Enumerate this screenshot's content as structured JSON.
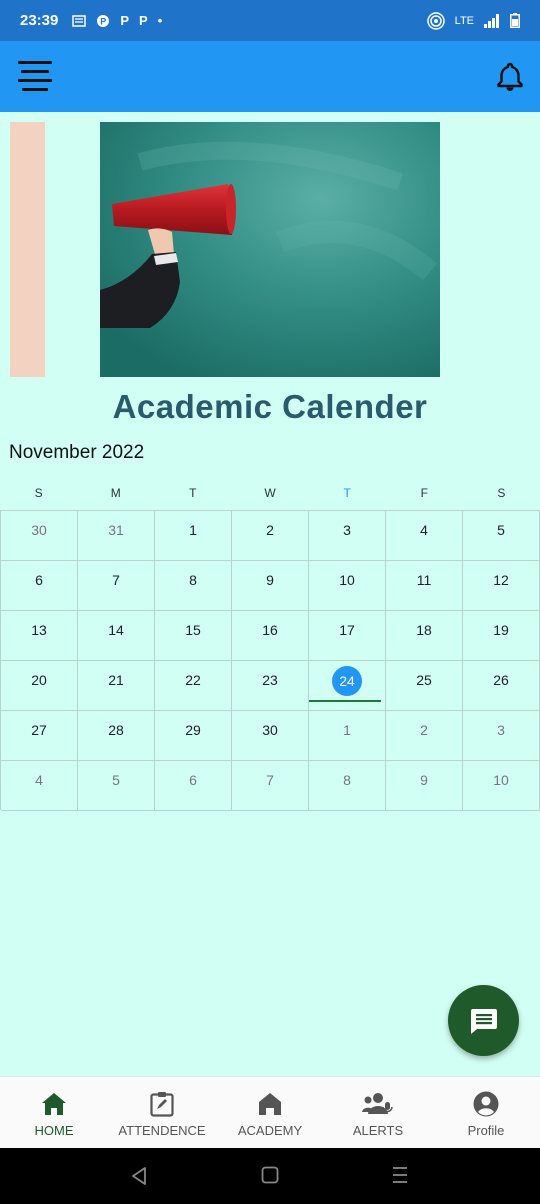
{
  "status_bar": {
    "time": "23:39",
    "left_icons": [
      "news-icon",
      "p-icon",
      "P",
      "P",
      "•"
    ],
    "network": "LTE"
  },
  "app_bar": {
    "menu_icon": "menu-icon",
    "notification_icon": "bell-icon"
  },
  "banner": {
    "image": "megaphone-chalkboard-image"
  },
  "page_title": "Academic Calender",
  "calendar": {
    "month_label": "November 2022",
    "weekdays": [
      "S",
      "M",
      "T",
      "W",
      "T",
      "F",
      "S"
    ],
    "today_column": 4,
    "weeks": [
      [
        "30",
        "31",
        "1",
        "2",
        "3",
        "4",
        "5"
      ],
      [
        "6",
        "7",
        "8",
        "9",
        "10",
        "11",
        "12"
      ],
      [
        "13",
        "14",
        "15",
        "16",
        "17",
        "18",
        "19"
      ],
      [
        "20",
        "21",
        "22",
        "23",
        "24",
        "25",
        "26"
      ],
      [
        "27",
        "28",
        "29",
        "30",
        "1",
        "2",
        "3"
      ],
      [
        "4",
        "5",
        "6",
        "7",
        "8",
        "9",
        "10"
      ]
    ],
    "muted": [
      [
        0,
        0
      ],
      [
        0,
        1
      ],
      [
        4,
        4
      ],
      [
        4,
        5
      ],
      [
        4,
        6
      ],
      [
        5,
        0
      ],
      [
        5,
        1
      ],
      [
        5,
        2
      ],
      [
        5,
        3
      ],
      [
        5,
        4
      ],
      [
        5,
        5
      ],
      [
        5,
        6
      ]
    ],
    "selected": [
      3,
      4
    ]
  },
  "fab": {
    "icon": "chat-icon"
  },
  "bottom_nav": [
    {
      "label": "HOME",
      "icon": "home-icon",
      "active": true
    },
    {
      "label": "ATTENDENCE",
      "icon": "clipboard-icon",
      "active": false
    },
    {
      "label": "ACADEMY",
      "icon": "academy-icon",
      "active": false
    },
    {
      "label": "ALERTS",
      "icon": "alerts-icon",
      "active": false
    },
    {
      "label": "Profile",
      "icon": "profile-icon",
      "active": false
    }
  ],
  "colors": {
    "status_bar": "#1f74c9",
    "app_bar": "#2196f3",
    "background": "#d2fff3",
    "title": "#2a5a6e",
    "accent_green": "#1e5a2a",
    "today": "#2196f3"
  }
}
